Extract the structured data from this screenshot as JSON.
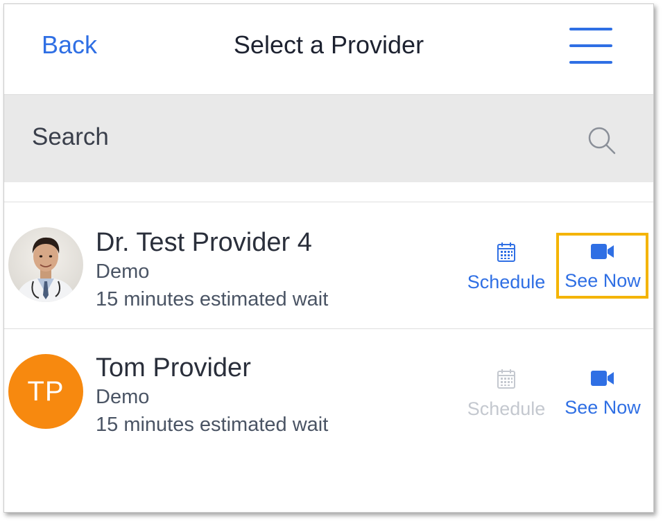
{
  "header": {
    "back_label": "Back",
    "title": "Select a Provider",
    "menu_icon": "hamburger-menu-icon"
  },
  "search": {
    "placeholder": "Search",
    "icon": "search-icon"
  },
  "providers": [
    {
      "name": "Dr. Test Provider 4",
      "practice": "Demo",
      "wait": "15 minutes estimated wait",
      "avatar": "provider-photo",
      "schedule_label": "Schedule",
      "schedule_enabled": true,
      "see_now_label": "See Now",
      "see_now_highlighted": true
    },
    {
      "name": "Tom Provider",
      "practice": "Demo",
      "wait": "15 minutes estimated wait",
      "initials": "TP",
      "schedule_label": "Schedule",
      "schedule_enabled": false,
      "see_now_label": "See Now",
      "see_now_highlighted": false
    }
  ],
  "colors": {
    "accent": "#2f6fe4",
    "disabled": "#c4c8cf",
    "avatar_bg": "#f7890f",
    "highlight": "#f4b400",
    "search_bg": "#e9e9e9"
  }
}
